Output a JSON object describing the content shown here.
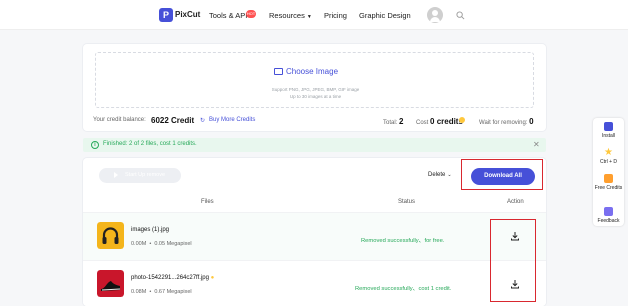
{
  "nav": {
    "brand": "PixCut",
    "items": [
      "Tools & API",
      "Resources",
      "Pricing",
      "Graphic Design"
    ],
    "hot_badge": "HOT"
  },
  "upload": {
    "choose_label": "Choose Image",
    "support_text": "Support PNG, JPG, JPEG, BMP, GIF image",
    "limit_text": "Up to 30 images at a time"
  },
  "credits": {
    "balance_label": "Your credit balance:",
    "balance_value": "6022 Credit",
    "buy_label": "Buy More Credits",
    "total_label": "Total:",
    "total_value": "2",
    "cost_label": "Cost",
    "cost_value": "0 credits",
    "waiting_label": "Wait for removing:",
    "waiting_value": "0"
  },
  "banner": {
    "text": "Finished: 2 of 2 files, cost 1 credits.",
    "color": "#27a95a"
  },
  "toolbar": {
    "start_label": "Start Up remove",
    "delete_label": "Delete",
    "download_all_label": "Download All",
    "accent": "#4650d8"
  },
  "table": {
    "headers": [
      "Files",
      "Status",
      "Action"
    ],
    "rows": [
      {
        "name": "images (1).jpg",
        "size": "0.00M",
        "pixels": "0.05 Megapixel",
        "status": "Removed successfully、for free."
      },
      {
        "name": "photo-1542291...264c27ff.jpg",
        "size": "0.08M",
        "pixels": "0.67 Megapixel",
        "status": "Removed successfully、cost 1 credit."
      }
    ]
  },
  "sidebar": {
    "items": [
      "Install",
      "Ctrl + D",
      "Free Credits",
      "Feedback"
    ]
  }
}
